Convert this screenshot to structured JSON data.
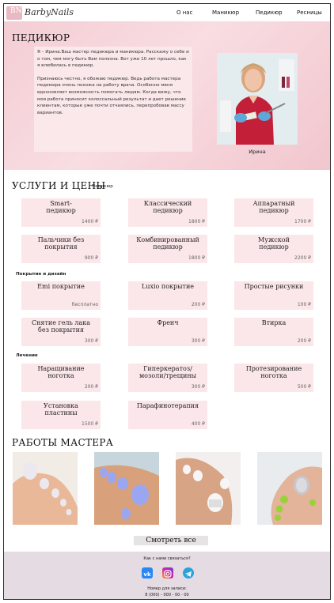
{
  "nav": {
    "logo_badge": "BN",
    "logo": "BarbyNails",
    "links": [
      "О нас",
      "Маникюр",
      "Педикюр",
      "Ресницы"
    ]
  },
  "hero": {
    "title": "ПЕДИКЮР",
    "para1": "Я – Ирина.Ваш мастер педикюра и маникюра. Расскажу о себе и о том, чем могу быть Вам полезна. Вот уже 10 лет прошло, как я влюбилась в педикюр.",
    "para2": "Признаюсь честно, я обожаю педикюр. Ведь работа мастера педикюра очень похожа на работу врача. Особенно меня вдохновляет возможность помогать людям. Когда вижу, что моя работа приносит колоссальный результат и дает решение клиентам, которые уже почти отчаялись, перепробовав массу вариантов.",
    "name": "Ирина"
  },
  "services": {
    "title": "УСЛУГИ И ЦЕНЫ",
    "subtitle": "Педикюр",
    "pedicure": [
      {
        "name": "Smart-\nпедикюр",
        "price": "1400 ₽"
      },
      {
        "name": "Классический\nпедикюр",
        "price": "1800 ₽"
      },
      {
        "name": "Аппаратный\nпедикюр",
        "price": "1700 ₽"
      },
      {
        "name": "Пальчики без\nпокрытия",
        "price": "900 ₽"
      },
      {
        "name": "Комбинированный\nпедикюр",
        "price": "1800 ₽"
      },
      {
        "name": "Мужской\nпедикюр",
        "price": "2200 ₽"
      }
    ],
    "coating_title": "Покрытие и дизайн",
    "coating": [
      {
        "name": "Emi покрытие",
        "price": "бесплатно"
      },
      {
        "name": "Luxio покрытие",
        "price": "200 ₽"
      },
      {
        "name": "Простые рисунки",
        "price": "100 ₽"
      },
      {
        "name": "Снятие гель лака\nбез покрытия",
        "price": "300 ₽"
      },
      {
        "name": "Френч",
        "price": "300 ₽"
      },
      {
        "name": "Втирка",
        "price": "200 ₽"
      }
    ],
    "treatment_title": "Лечение",
    "treatment": [
      {
        "name": "Наращивание\nноготка",
        "price": "200 ₽"
      },
      {
        "name": "Гиперкератоз/\nмозоли/трещины",
        "price": "300 ₽"
      },
      {
        "name": "Протезирование\nноготка",
        "price": "500 ₽"
      },
      {
        "name": "Установка\nпластины",
        "price": "1500 ₽"
      },
      {
        "name": "Парафинотерапия",
        "price": "400 ₽"
      }
    ]
  },
  "works": {
    "title": "РАБОТЫ МАСТЕРА",
    "button": "Смотреть все"
  },
  "footer": {
    "question": "Как с нами связаться?",
    "phone_label": "Номер для записи:",
    "phone": "8 (000) - 000 - 00 - 00",
    "colors": {
      "vk": "#2787f5",
      "ig": "#d6249f",
      "tg": "#2aa3dc"
    }
  }
}
